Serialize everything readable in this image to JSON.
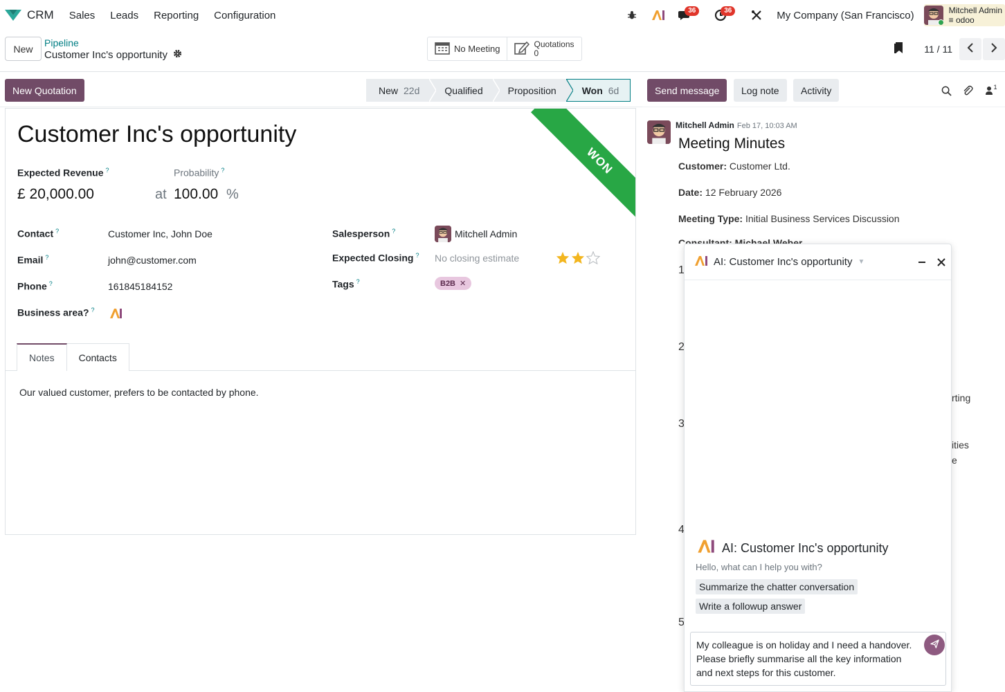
{
  "navbar": {
    "app_name": "CRM",
    "menu": [
      "Sales",
      "Leads",
      "Reporting",
      "Configuration"
    ],
    "activity_badge": "36",
    "clock_badge": "36",
    "company": "My Company (San Francisco)",
    "user_name": "Mitchell Admin",
    "user_db": "odoo"
  },
  "control_panel": {
    "new_label": "New",
    "breadcrumb_parent": "Pipeline",
    "breadcrumb_current": "Customer Inc's opportunity",
    "smart_meeting": "No Meeting",
    "smart_quotations_label": "Quotations",
    "smart_quotations_count": "0",
    "pager": "11 / 11"
  },
  "status": {
    "new_quotation": "New Quotation",
    "stages": [
      {
        "label": "New",
        "days": "22d"
      },
      {
        "label": "Qualified",
        "days": ""
      },
      {
        "label": "Proposition",
        "days": ""
      },
      {
        "label": "Won",
        "days": "6d"
      }
    ]
  },
  "form": {
    "title": "Customer Inc's opportunity",
    "ribbon": "WON",
    "expected_revenue_label": "Expected Revenue",
    "expected_revenue": "£ 20,000.00",
    "probability_label": "Probability",
    "probability_at": "at",
    "probability": "100.00",
    "probability_unit": "%",
    "contact_label": "Contact",
    "contact": "Customer Inc, John Doe",
    "email_label": "Email",
    "email": "john@customer.com",
    "phone_label": "Phone",
    "phone": "161845184152",
    "business_area_label": "Business area?",
    "salesperson_label": "Salesperson",
    "salesperson": "Mitchell Admin",
    "expected_closing_label": "Expected Closing",
    "expected_closing_placeholder": "No closing estimate",
    "priority_stars": 2,
    "priority_max": 3,
    "tags_label": "Tags",
    "tag": "B2B",
    "tabs": [
      "Notes",
      "Contacts"
    ],
    "notes": "Our valued customer, prefers to be contacted by phone."
  },
  "chatter": {
    "send_message": "Send message",
    "log_note": "Log note",
    "activity": "Activity",
    "follower_count": "1",
    "message": {
      "author": "Mitchell Admin",
      "date": "Feb 17, 10:03 AM",
      "title": "Meeting Minutes",
      "customer_label": "Customer:",
      "customer": "Customer Ltd.",
      "date_label": "Date:",
      "date_value": "12 February 2026",
      "meeting_type_label": "Meeting Type:",
      "meeting_type": "Initial Business Services Discussion",
      "consultant_partial": "Consultant: Michael Weber",
      "list_numbers": [
        "1",
        "2",
        "3",
        "4",
        "5"
      ],
      "tail_1": "rting",
      "tail_2": "ities",
      "tail_3": "e"
    }
  },
  "ai": {
    "header_title": "AI: Customer Inc's opportunity",
    "body_title": "AI: Customer Inc's opportunity",
    "greeting": "Hello, what can I help you with?",
    "suggestions": [
      "Summarize the chatter conversation",
      "Write a followup answer"
    ],
    "input_text": "My colleague is on holiday and I need a handover. Please briefly summarise all the key information and next steps for this customer."
  },
  "colors": {
    "brand": "#714b67",
    "link": "#017e84",
    "won_ribbon": "#28a745",
    "badge": "#e0352a",
    "star": "#f3b61f"
  }
}
